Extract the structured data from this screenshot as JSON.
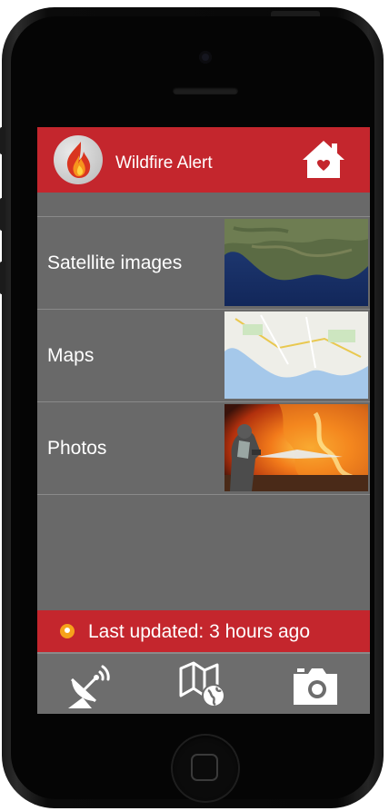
{
  "header": {
    "title": "Wildfire Alert"
  },
  "menu": {
    "items": [
      {
        "label": "Satellite images"
      },
      {
        "label": "Maps"
      },
      {
        "label": "Photos"
      }
    ]
  },
  "status": {
    "text": "Last updated: 3 hours ago"
  },
  "tabs": [
    {
      "icon": "satellite-dish-icon"
    },
    {
      "icon": "world-map-icon"
    },
    {
      "icon": "camera-icon"
    }
  ],
  "colors": {
    "brand_red": "#c4262d",
    "panel_gray": "#696969",
    "clock_orange": "#f6a21b"
  }
}
